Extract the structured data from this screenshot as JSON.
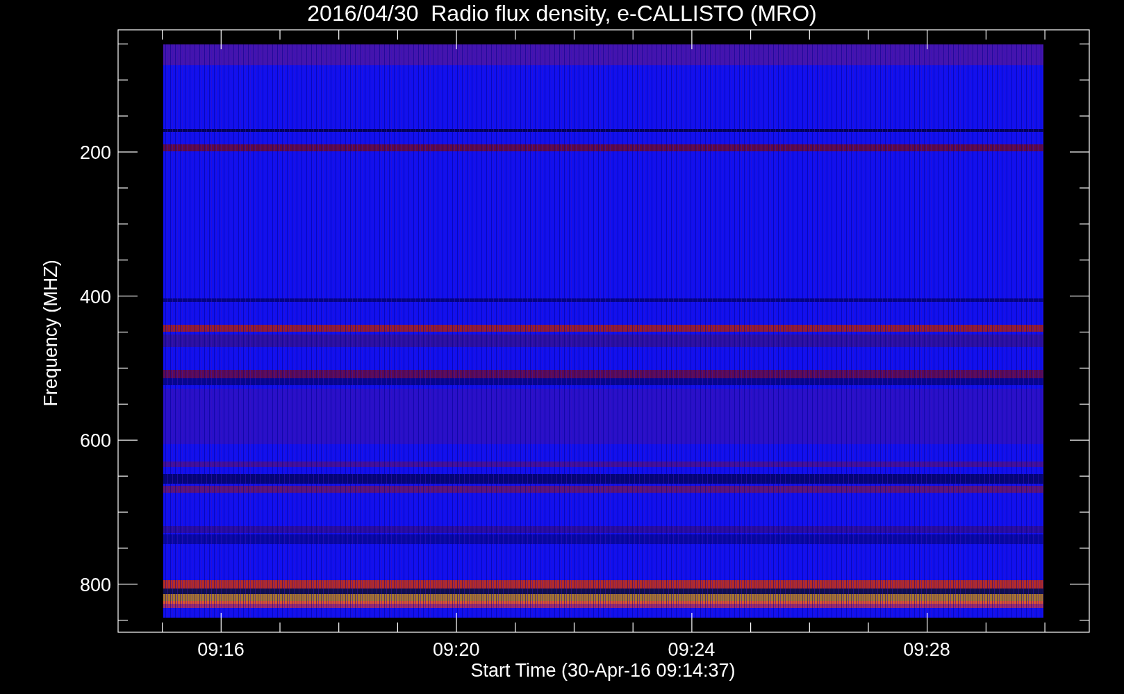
{
  "title": "2016/04/30  Radio flux density, e-CALLISTO (MRO)",
  "plot": {
    "ylabel": "Frequency (MHZ)",
    "xlabel": "Start Time (30-Apr-16 09:14:37)",
    "yticks": [
      "200",
      "400",
      "600",
      "800"
    ],
    "xticks": [
      "09:16",
      "09:20",
      "09:24",
      "09:28"
    ]
  }
}
